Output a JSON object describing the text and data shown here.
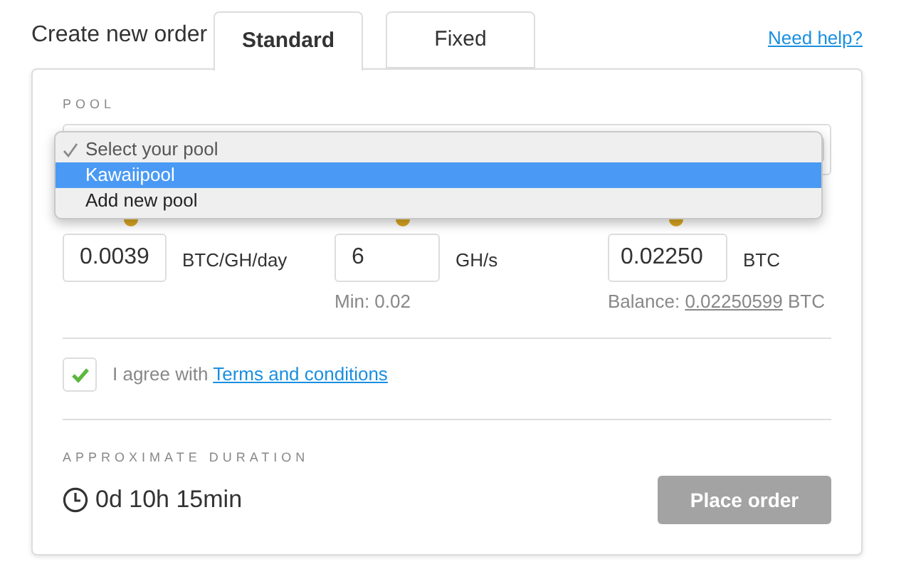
{
  "header": {
    "title": "Create new order",
    "help_link": "Need help?"
  },
  "tabs": [
    {
      "label": "Standard",
      "selected": true
    },
    {
      "label": "Fixed",
      "selected": false
    }
  ],
  "pool": {
    "label": "POOL",
    "options": [
      {
        "label": "Select your pool",
        "checked": true,
        "selected": false
      },
      {
        "label": "Kawaiipool",
        "checked": false,
        "selected": true
      },
      {
        "label": "Add new pool",
        "checked": false,
        "selected": false
      }
    ]
  },
  "fields": [
    {
      "value": "0.0039",
      "unit": "BTC/GH/day"
    },
    {
      "value": "6",
      "unit": "GH/s",
      "note": "Min: 0.02"
    },
    {
      "value": "0.02250",
      "unit": "BTC",
      "note": "Balance: ",
      "note_link": "0.02250599",
      "note_suffix": " BTC"
    }
  ],
  "agreement": {
    "checked": true,
    "text": "I agree with ",
    "link": "Terms and conditions"
  },
  "duration": {
    "label": "APPROXIMATE DURATION",
    "value": "0d 10h 15min"
  },
  "submit": {
    "label": "Place order",
    "disabled": true
  }
}
